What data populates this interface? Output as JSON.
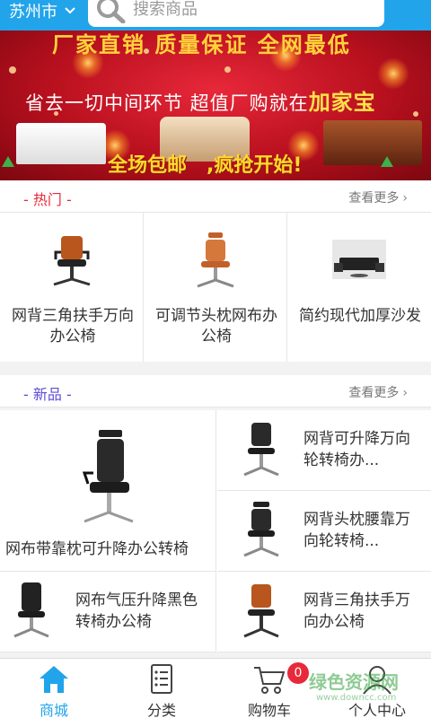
{
  "header": {
    "city": "苏州市",
    "search_placeholder": "搜索商品"
  },
  "banner": {
    "slogan_top": "厂家直销 质量保证 全网最低",
    "slogan_mid": "省去一切中间环节 超值厂购就在",
    "brand": "加家宝",
    "promo_a": "全场包邮",
    "promo_b": ",疯抢开始!"
  },
  "hot": {
    "title": "- 热门 -",
    "more": "查看更多",
    "title_color": "#e8293a",
    "items": [
      {
        "name": "网背三角扶手万向办公椅",
        "icon": "black-office-chair-icon"
      },
      {
        "name": "可调节头枕网布办公椅",
        "icon": "orange-mesh-chair-icon"
      },
      {
        "name": "简约现代加厚沙发",
        "icon": "black-sofa-set-icon"
      }
    ]
  },
  "new": {
    "title": "- 新品 -",
    "more": "查看更多",
    "title_color": "#5c4bd8",
    "items": [
      {
        "name": "网布带靠枕可升降办公转椅",
        "icon": "black-high-back-chair-icon"
      },
      {
        "name": "网背可升降万向轮转椅办...",
        "icon": "black-mesh-chair-icon"
      },
      {
        "name": "网背头枕腰靠万向轮转椅...",
        "icon": "black-headrest-chair-icon"
      },
      {
        "name": "网布气压升降黑色转椅办公椅",
        "icon": "black-tall-chair-icon"
      },
      {
        "name": "网背三角扶手万向办公椅",
        "icon": "orange-mesh-chair-icon"
      }
    ]
  },
  "tabs": [
    {
      "label": "商城",
      "icon": "house-icon",
      "active": true
    },
    {
      "label": "分类",
      "icon": "list-icon",
      "active": false
    },
    {
      "label": "购物车",
      "icon": "cart-icon",
      "active": false,
      "badge": "0"
    },
    {
      "label": "个人中心",
      "icon": "person-icon",
      "active": false
    }
  ],
  "watermark": {
    "text": "绿色资源网",
    "sub": "www.downcc.com"
  },
  "accent": "#21a4ea"
}
